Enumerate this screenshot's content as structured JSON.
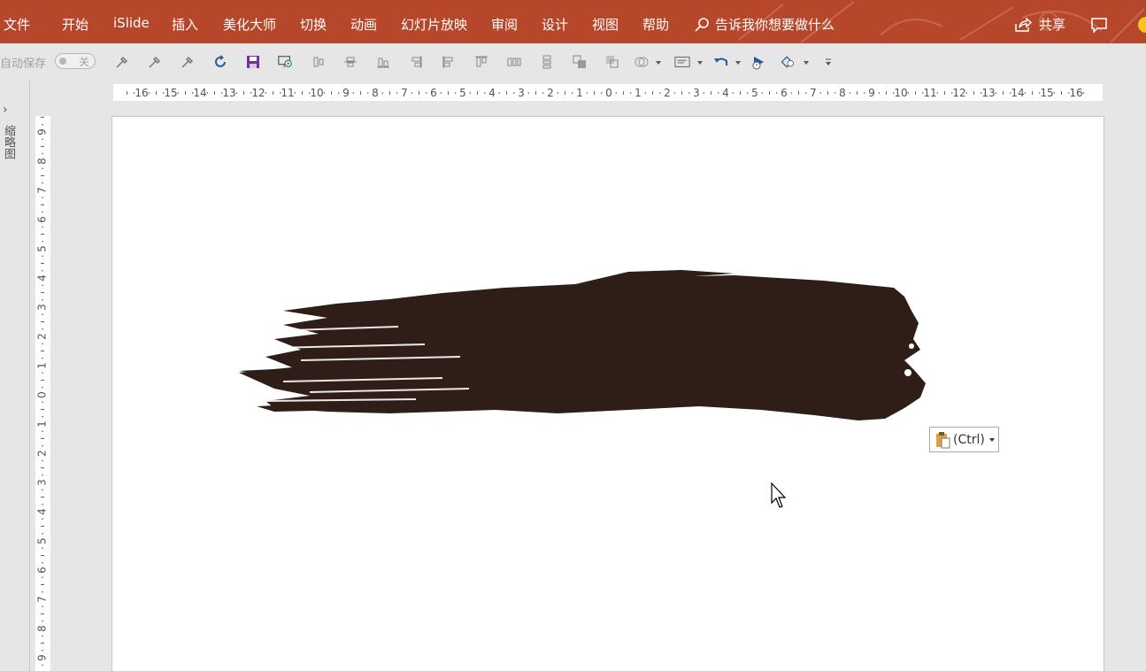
{
  "ribbon": {
    "tabs": [
      "文件",
      "开始",
      "iSlide",
      "插入",
      "美化大师",
      "切换",
      "动画",
      "幻灯片放映",
      "审阅",
      "设计",
      "视图",
      "帮助"
    ],
    "tell_me": "告诉我你想要做什么",
    "share": "共享"
  },
  "quick_access": {
    "autosave_label": "自动保存",
    "autosave_state": "关"
  },
  "thumbnail_pane": {
    "label": "缩略图"
  },
  "ruler": {
    "horizontal_ticks": [
      "16",
      "15",
      "14",
      "13",
      "12",
      "11",
      "10",
      "9",
      "8",
      "7",
      "6",
      "5",
      "4",
      "3",
      "2",
      "1",
      "0",
      "1",
      "2",
      "3",
      "4",
      "5",
      "6",
      "7",
      "8",
      "9",
      "10",
      "11",
      "12",
      "13",
      "14",
      "15",
      "16"
    ],
    "vertical_ticks": [
      "9",
      "8",
      "7",
      "6",
      "5",
      "4",
      "3",
      "2",
      "1",
      "0",
      "1",
      "2",
      "3",
      "4",
      "5",
      "6",
      "7",
      "8",
      "9"
    ]
  },
  "slide": {
    "brush_color": "#2e1e17"
  },
  "paste_options": {
    "label": "(Ctrl)"
  },
  "colors": {
    "ribbon": "#b7472a",
    "workspace": "#e6e6e6",
    "accent_blue": "#2b579a",
    "save_purple": "#7030a0"
  }
}
